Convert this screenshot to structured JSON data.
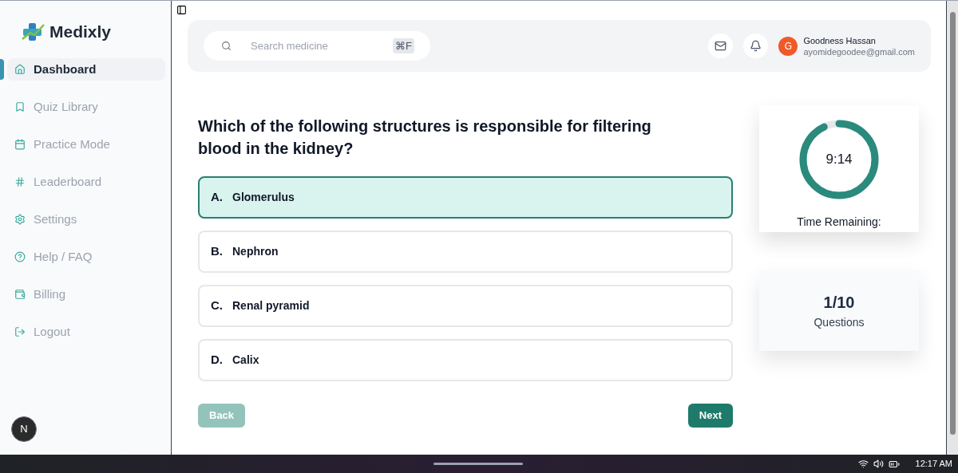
{
  "sidebar": {
    "logo": "Medixly",
    "items": [
      {
        "label": "Dashboard",
        "selected": true
      },
      {
        "label": "Quiz Library",
        "selected": false
      },
      {
        "label": "Practice Mode",
        "selected": false
      },
      {
        "label": "Leaderboard",
        "selected": false
      },
      {
        "label": "Settings",
        "selected": false
      },
      {
        "label": "Help / FAQ",
        "selected": false
      },
      {
        "label": "Billing",
        "selected": false
      },
      {
        "label": "Logout",
        "selected": false
      }
    ],
    "dev_badge": "N"
  },
  "header": {
    "search": {
      "placeholder": "Search medicine",
      "shortcut": "⌘F"
    },
    "user": {
      "initial": "G",
      "name": "Goodness Hassan",
      "email": "ayomidegoodee@gmail.com"
    }
  },
  "question": {
    "text": "Which of the following structures is responsible for filtering blood in the kidney?",
    "options": [
      {
        "letter": "A.",
        "text": "Glomerulus",
        "selected": true
      },
      {
        "letter": "B.",
        "text": "Nephron",
        "selected": false
      },
      {
        "letter": "C.",
        "text": "Renal pyramid",
        "selected": false
      },
      {
        "letter": "D.",
        "text": "Calix",
        "selected": false
      }
    ]
  },
  "buttons": [
    {
      "label": "Back",
      "disabled": true
    },
    {
      "label": "Next",
      "disabled": false
    }
  ],
  "timer": {
    "reading": "9:14",
    "label": "Time Remaining:"
  },
  "progress": {
    "count": "1/10",
    "label": "Questions"
  },
  "taskbar": {
    "time": "12:17 AM"
  }
}
